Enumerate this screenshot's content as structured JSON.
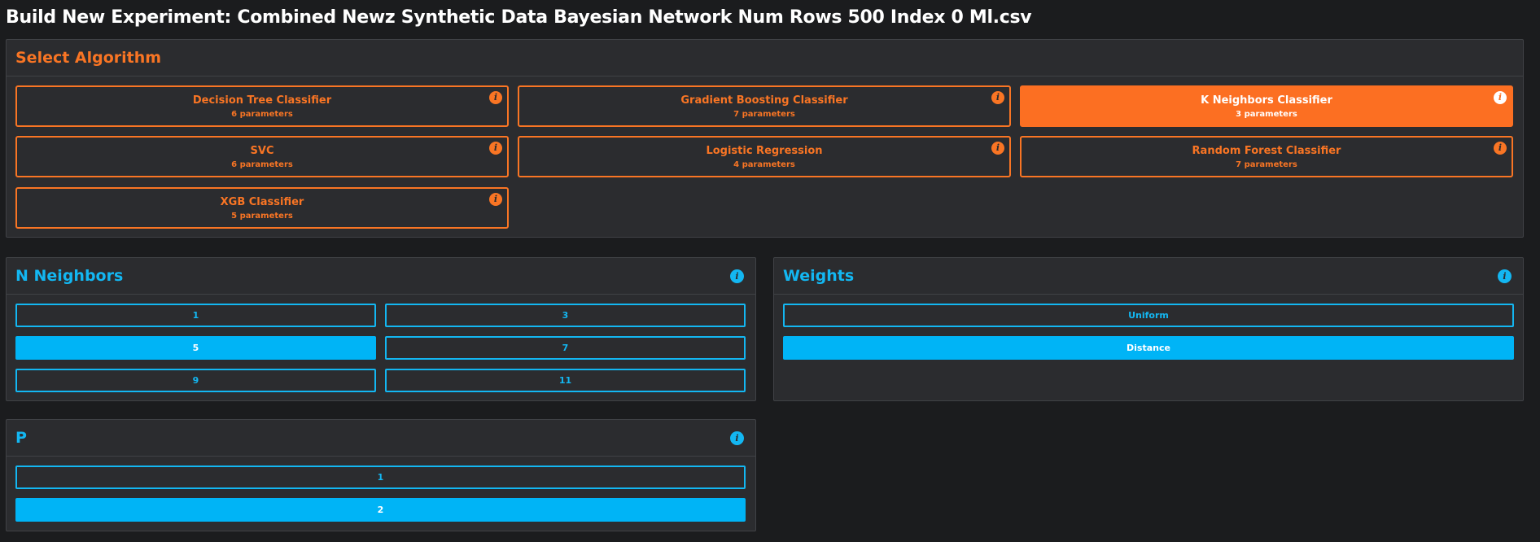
{
  "page": {
    "title": "Build New Experiment: Combined Newz Synthetic Data Bayesian Network Num Rows 500 Index 0 Ml.csv"
  },
  "colors": {
    "background": "#1b1c1e",
    "panel": "#2b2c2f",
    "algorithm_accent": "#f97524",
    "option_accent": "#13b7f2"
  },
  "algorithm_section": {
    "title": "Select Algorithm",
    "selected": "K Neighbors Classifier",
    "algorithms": [
      {
        "name": "Decision Tree Classifier",
        "params": "6 parameters",
        "info_icon": "info-icon"
      },
      {
        "name": "Gradient Boosting Classifier",
        "params": "7 parameters",
        "info_icon": "info-icon"
      },
      {
        "name": "K Neighbors Classifier",
        "params": "3 parameters",
        "info_icon": "info-icon"
      },
      {
        "name": "SVC",
        "params": "6 parameters",
        "info_icon": "info-icon"
      },
      {
        "name": "Logistic Regression",
        "params": "4 parameters",
        "info_icon": "info-icon"
      },
      {
        "name": "Random Forest Classifier",
        "params": "7 parameters",
        "info_icon": "info-icon"
      },
      {
        "name": "XGB Classifier",
        "params": "5 parameters",
        "info_icon": "info-icon"
      }
    ]
  },
  "n_neighbors": {
    "title": "N Neighbors",
    "selected": "5",
    "options": [
      "1",
      "3",
      "5",
      "7",
      "9",
      "11"
    ]
  },
  "weights": {
    "title": "Weights",
    "selected": "Distance",
    "options": [
      "Uniform",
      "Distance"
    ]
  },
  "p": {
    "title": "P",
    "selected": "2",
    "options": [
      "1",
      "2"
    ]
  },
  "icons": {
    "info": "i"
  }
}
